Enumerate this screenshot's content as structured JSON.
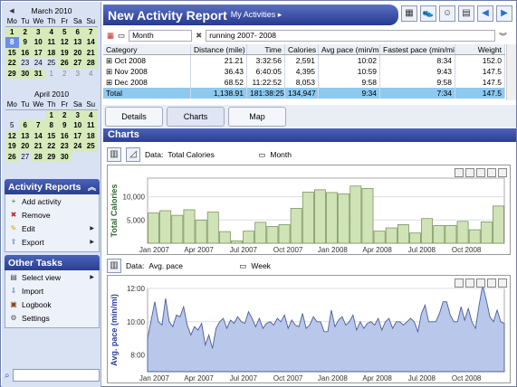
{
  "calendars": [
    {
      "title": "March 2010",
      "dow": [
        "Mo",
        "Tu",
        "We",
        "Th",
        "Fr",
        "Sa",
        "Su"
      ],
      "days": [
        "1",
        "2",
        "3",
        "4",
        "5",
        "6",
        "7",
        "8",
        "9",
        "10",
        "11",
        "12",
        "13",
        "14",
        "15",
        "16",
        "17",
        "18",
        "19",
        "20",
        "21",
        "22",
        "23",
        "24",
        "25",
        "26",
        "27",
        "28",
        "29",
        "30",
        "31"
      ],
      "start": 0,
      "active": [
        1,
        2,
        3,
        4,
        5,
        6,
        7,
        8,
        9,
        10,
        11,
        12,
        13,
        14,
        15,
        16,
        17,
        18,
        19,
        20,
        21,
        22,
        26,
        27,
        28,
        29,
        30,
        31
      ],
      "selected": [
        8
      ],
      "trailing": [
        "1",
        "2",
        "3",
        "4"
      ]
    },
    {
      "title": "April 2010",
      "dow": [
        "Mo",
        "Tu",
        "We",
        "Th",
        "Fr",
        "Sa",
        "Su"
      ],
      "days": [
        "1",
        "2",
        "3",
        "4",
        "5",
        "6",
        "7",
        "8",
        "9",
        "10",
        "11",
        "12",
        "13",
        "14",
        "15",
        "16",
        "17",
        "18",
        "19",
        "20",
        "21",
        "22",
        "23",
        "24",
        "25",
        "26",
        "27",
        "28",
        "29",
        "30"
      ],
      "start": 3,
      "active": [
        1,
        2,
        3,
        4,
        6,
        7,
        8,
        9,
        10,
        11,
        12,
        13,
        14,
        15,
        16,
        17,
        18,
        19,
        20,
        21,
        22,
        23,
        24,
        25,
        26,
        28,
        29,
        30
      ],
      "selected": [],
      "trailing": []
    }
  ],
  "activity_reports": {
    "title": "Activity Reports",
    "items": [
      {
        "label": "Add activity",
        "icon": "add-activity-icon",
        "glyph": "+",
        "color": "#2e7d32",
        "sub": false
      },
      {
        "label": "Remove",
        "icon": "remove-icon",
        "glyph": "✖",
        "color": "#c62828",
        "sub": false
      },
      {
        "label": "Edit",
        "icon": "edit-icon",
        "glyph": "✎",
        "color": "#e0a100",
        "sub": true
      },
      {
        "label": "Export",
        "icon": "export-icon",
        "glyph": "⇪",
        "color": "#2a5db0",
        "sub": true
      }
    ]
  },
  "other_tasks": {
    "title": "Other Tasks",
    "items": [
      {
        "label": "Select view",
        "icon": "select-view-icon",
        "glyph": "▤",
        "color": "#445",
        "sub": true
      },
      {
        "label": "Import",
        "icon": "import-icon",
        "glyph": "⇩",
        "color": "#2a5db0",
        "sub": false
      },
      {
        "label": "Logbook",
        "icon": "logbook-icon",
        "glyph": "▣",
        "color": "#8b4513",
        "sub": false
      },
      {
        "label": "Settings",
        "icon": "settings-icon",
        "glyph": "⚙",
        "color": "#555",
        "sub": false
      }
    ]
  },
  "header": {
    "title": "New Activity Report",
    "crumb": "My Activities ▸"
  },
  "filter": {
    "period": "Month",
    "search": "running 2007- 2008"
  },
  "table": {
    "columns": [
      "Category",
      "Distance (mile)",
      "Time",
      "Calories",
      "Avg pace (min/mi)",
      "Fastest pace (min/mi)",
      "Weight"
    ],
    "rows": [
      [
        "⊞ Oct 2008",
        "21.21",
        "3:32:56",
        "2,591",
        "10:02",
        "8:34",
        "152.0"
      ],
      [
        "⊞ Nov 2008",
        "36.43",
        "6:40:05",
        "4,395",
        "10:59",
        "9:43",
        "147.5"
      ],
      [
        "⊞ Dec 2008",
        "68.52",
        "11:22:52",
        "8,053",
        "9:58",
        "9:58",
        "147.5"
      ]
    ],
    "total": [
      "Total",
      "1,138.91",
      "181:38:25",
      "134,947",
      "9:34",
      "7:34",
      "147.5"
    ]
  },
  "tabs": [
    "Details",
    "Charts",
    "Map"
  ],
  "charts_header": "Charts",
  "chart1_bar": {
    "data_label": "Data:",
    "data_value": "Total Calories",
    "period": "Month"
  },
  "chart2_bar": {
    "data_label": "Data:",
    "data_value": "Avg. pace",
    "period": "Week"
  },
  "chart_data": [
    {
      "type": "bar",
      "ylabel": "Total Calories",
      "ylim": [
        0,
        14000
      ],
      "yticks": [
        "5,000",
        "10,000"
      ],
      "xticks": [
        "Jan 2007",
        "Apr 2007",
        "Jul 2007",
        "Oct 2007",
        "Jan 2008",
        "Apr 2008",
        "Jul 2008",
        "Oct 2008"
      ],
      "values": [
        6500,
        7000,
        6000,
        7200,
        5000,
        6700,
        2500,
        500,
        2600,
        4500,
        3600,
        4000,
        7500,
        11000,
        11500,
        10900,
        10600,
        12300,
        11800,
        2600,
        3300,
        4000,
        2200,
        5300,
        3800,
        3800,
        4700,
        2900,
        4600,
        8000
      ],
      "color": "#cfe3b7",
      "stroke": "#6d8a4e",
      "grid": true
    },
    {
      "type": "area",
      "ylabel": "Avg. pace (min/mi)",
      "ylim": [
        7,
        12
      ],
      "yticks": [
        "8:00",
        "10:00",
        "12:00"
      ],
      "xticks": [
        "Jan 2007",
        "Apr 2007",
        "Jul 2007",
        "Oct 2007",
        "Jan 2008",
        "Apr 2008",
        "Jul 2008",
        "Oct 2008"
      ],
      "values": [
        9.0,
        10.1,
        11.2,
        10.0,
        9.8,
        11.4,
        10.0,
        9.7,
        10.4,
        10.3,
        10.9,
        9.8,
        9.2,
        9.7,
        9.5,
        9.9,
        8.6,
        9.2,
        8.4,
        9.6,
        10.0,
        10.2,
        9.6,
        10.1,
        9.9,
        10.3,
        10.0,
        9.9,
        10.6,
        10.2,
        9.7,
        10.2,
        9.6,
        9.9,
        10.0,
        9.8,
        10.2,
        10.0,
        10.4,
        9.6,
        10.1,
        9.8,
        9.7,
        10.5,
        9.6,
        9.8,
        10.3,
        10.0,
        10.0,
        9.4,
        9.4,
        10.7,
        9.7,
        10.1,
        10.3,
        9.8,
        10.0,
        10.4,
        9.5,
        10.0,
        9.6,
        9.9,
        10.0,
        9.8,
        10.2,
        9.5,
        10.0,
        10.2,
        9.6,
        10.0,
        10.0,
        9.8,
        10.0,
        10.2,
        10.0,
        9.4,
        10.5,
        11.0,
        10.0,
        10.0,
        10.0,
        10.5,
        11.2,
        11.2,
        10.4,
        10.0,
        10.0,
        10.9,
        10.1,
        10.8,
        10.0,
        9.6,
        11.0,
        12.2,
        11.3,
        10.3,
        10.0,
        10.7,
        10.0,
        9.9
      ],
      "color": "#b9c8ea",
      "stroke": "#4a5d9e",
      "grid": true
    }
  ]
}
